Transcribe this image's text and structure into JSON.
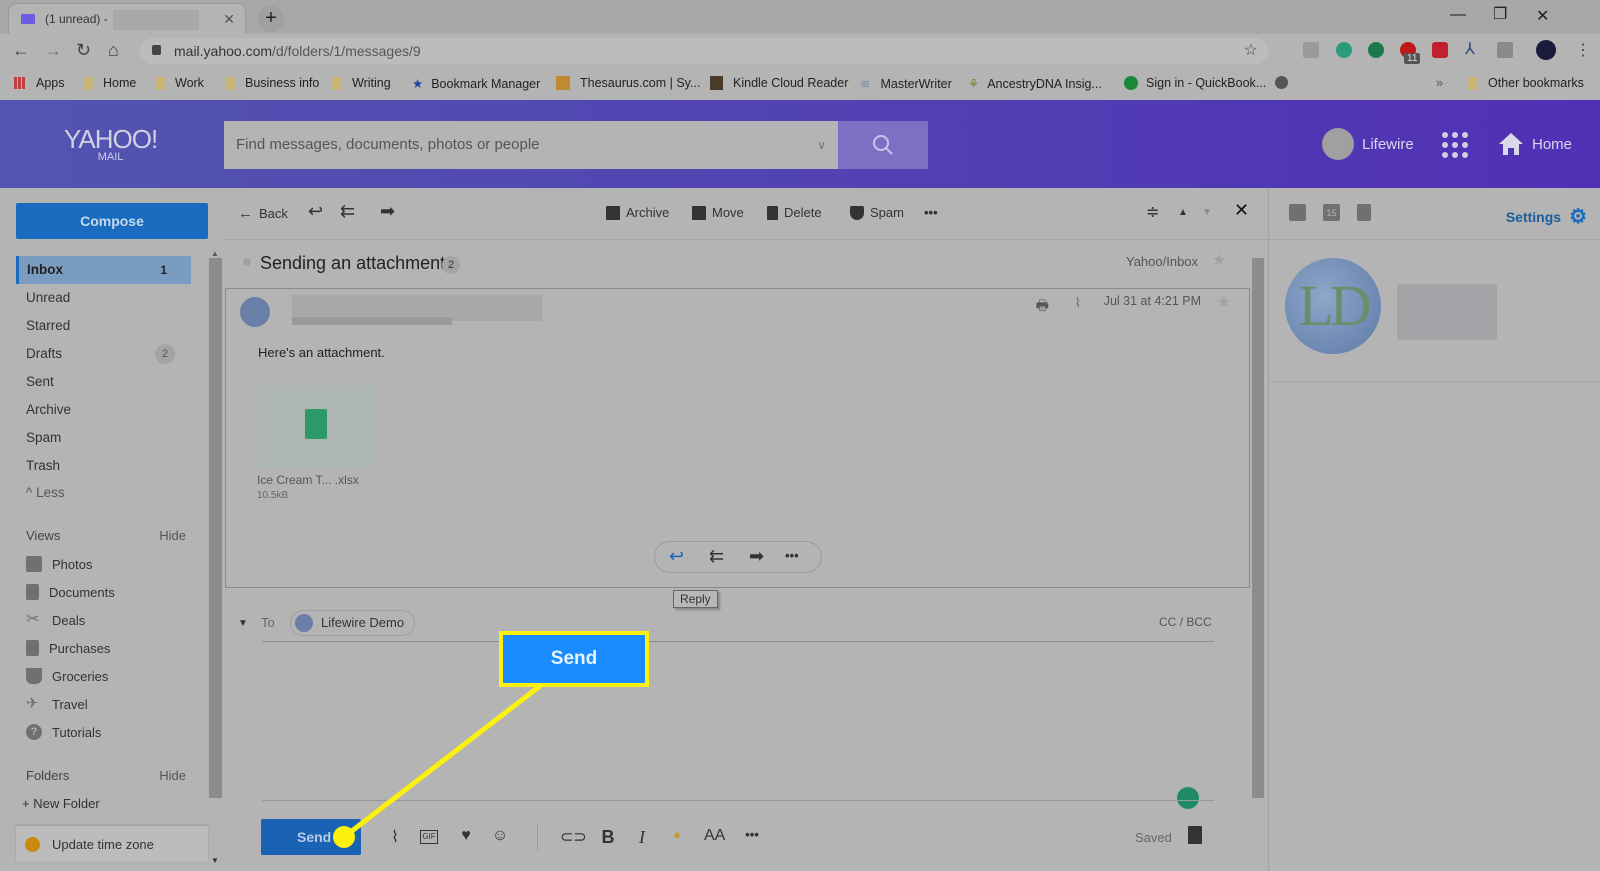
{
  "browser": {
    "tab_title": "(1 unread) -",
    "new_tab": "+",
    "url_host": "mail.yahoo.com",
    "url_path": "/d/folders/1/messages/9",
    "extension_badge": "11",
    "bookmarks": [
      {
        "label": "Apps"
      },
      {
        "label": "Home"
      },
      {
        "label": "Work"
      },
      {
        "label": "Business info"
      },
      {
        "label": "Writing"
      },
      {
        "label": "Bookmark Manager"
      },
      {
        "label": "Thesaurus.com | Sy..."
      },
      {
        "label": "Kindle Cloud Reader"
      },
      {
        "label": "MasterWriter"
      },
      {
        "label": "AncestryDNA Insig..."
      },
      {
        "label": "Sign in - QuickBook..."
      }
    ],
    "bookmarks_overflow": "»",
    "other_bookmarks": "Other bookmarks"
  },
  "header": {
    "logo": "YAHOO!",
    "logo_sub": "MAIL",
    "search_placeholder": "Find messages, documents, photos or people",
    "user_name": "Lifewire",
    "home_label": "Home"
  },
  "sidebar": {
    "compose_label": "Compose",
    "folders": [
      {
        "label": "Inbox",
        "count": "1",
        "active": true
      },
      {
        "label": "Unread"
      },
      {
        "label": "Starred"
      },
      {
        "label": "Drafts",
        "pill": "2"
      },
      {
        "label": "Sent"
      },
      {
        "label": "Archive"
      },
      {
        "label": "Spam"
      },
      {
        "label": "Trash"
      }
    ],
    "less_label": "Less",
    "views_label": "Views",
    "views_hide": "Hide",
    "views": [
      {
        "label": "Photos",
        "icon": "photo-icon"
      },
      {
        "label": "Documents",
        "icon": "document-icon"
      },
      {
        "label": "Deals",
        "icon": "scissors-icon"
      },
      {
        "label": "Purchases",
        "icon": "receipt-icon"
      },
      {
        "label": "Groceries",
        "icon": "basket-icon"
      },
      {
        "label": "Travel",
        "icon": "plane-icon"
      },
      {
        "label": "Tutorials",
        "icon": "help-icon"
      }
    ],
    "folders_label": "Folders",
    "folders_hide": "Hide",
    "new_folder": "+ New Folder",
    "timezone_label": "Update time zone"
  },
  "toolbar": {
    "back": "Back",
    "archive": "Archive",
    "move": "Move",
    "delete": "Delete",
    "spam": "Spam",
    "more": "•••"
  },
  "right_pane": {
    "settings_label": "Settings",
    "avatar_initials": "LD"
  },
  "thread": {
    "subject": "Sending an attachment",
    "count": "2",
    "folder": "Yahoo/Inbox",
    "message": {
      "date": "Jul 31 at 4:21 PM",
      "body": "Here's an attachment.",
      "attachment_name": "Ice Cream T... .xlsx",
      "attachment_size": "10.5kB"
    },
    "tooltip": "Reply"
  },
  "compose": {
    "to_label": "To",
    "recipient": "Lifewire Demo",
    "cc_bcc": "CC / BCC",
    "send_label": "Send",
    "saved_label": "Saved"
  },
  "callout": {
    "label": "Send",
    "border_color": "#fbf00e",
    "fill_color": "#1a8cff"
  }
}
